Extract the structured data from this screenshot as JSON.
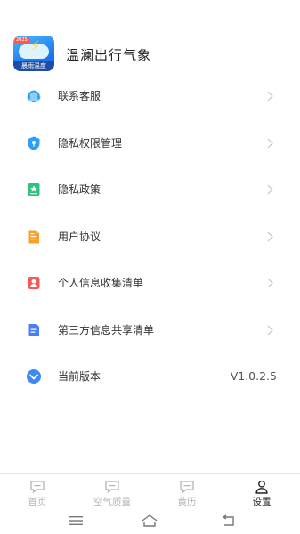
{
  "header": {
    "app_name": "温澜出行气象",
    "logo_ribbon": "晨雨温度",
    "logo_tag": "2025"
  },
  "menu": [
    {
      "label": "联系客服",
      "icon": "headset-icon",
      "color": "#35a9f2"
    },
    {
      "label": "隐私权限管理",
      "icon": "shield-lock-icon",
      "color": "#2f9df4"
    },
    {
      "label": "隐私政策",
      "icon": "privacy-badge-icon",
      "color": "#2ec27e"
    },
    {
      "label": "用户协议",
      "icon": "document-icon",
      "color": "#f7a12b"
    },
    {
      "label": "个人信息收集清单",
      "icon": "person-card-icon",
      "color": "#f25a5a"
    },
    {
      "label": "第三方信息共享清单",
      "icon": "share-doc-icon",
      "color": "#4a7ff5"
    },
    {
      "label": "当前版本",
      "icon": "version-check-icon",
      "color": "#3b8af6",
      "value": "V1.0.2.5"
    }
  ],
  "tabs": [
    {
      "label": "首页",
      "icon": "home-chat-icon",
      "active": false
    },
    {
      "label": "空气质量",
      "icon": "air-quality-icon",
      "active": false
    },
    {
      "label": "黄历",
      "icon": "almanac-icon",
      "active": false
    },
    {
      "label": "设置",
      "icon": "user-icon",
      "active": true
    }
  ],
  "colors": {
    "chevron": "#c4c4c4",
    "tab_inactive": "#b3b3b3",
    "tab_active": "#222222"
  }
}
